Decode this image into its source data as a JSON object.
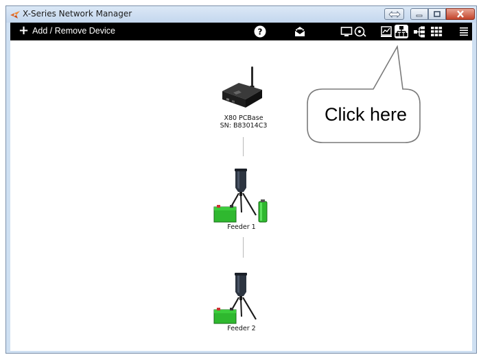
{
  "window": {
    "title": "X-Series Network Manager"
  },
  "toolbar": {
    "add_remove_label": "Add / Remove Device",
    "icons": [
      "help-icon",
      "mail-icon",
      "monitor-icon",
      "settings-icon",
      "chart-icon",
      "network-tree-icon",
      "hierarchy-icon",
      "grid-icon",
      "menu-icon"
    ]
  },
  "devices": {
    "base": {
      "line1": "X80 PCBase",
      "line2": "SN: B83014C3"
    },
    "feeder1": {
      "label": "Feeder 1"
    },
    "feeder2": {
      "label": "Feeder 2"
    }
  },
  "callout": {
    "text": "Click here"
  },
  "colors": {
    "toolbar_bg": "#000000",
    "battery_green": "#2fb82f",
    "close_red": "#c3432a"
  }
}
